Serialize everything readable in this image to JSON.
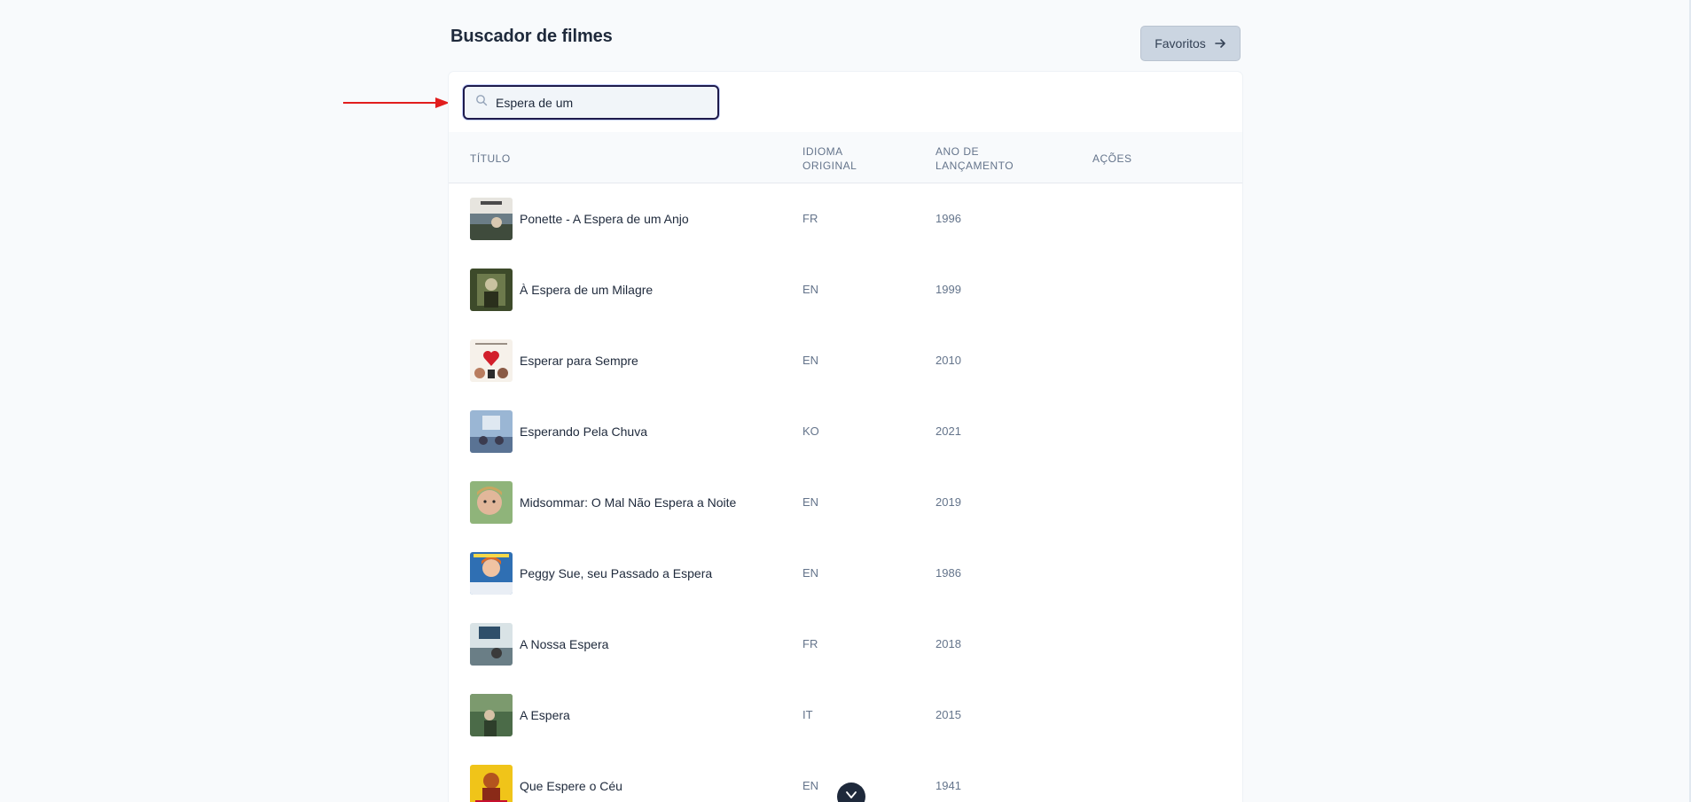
{
  "header": {
    "title": "Buscador de filmes",
    "favorites_label": "Favoritos"
  },
  "search": {
    "value": "Espera de um",
    "placeholder": ""
  },
  "table": {
    "columns": {
      "title": "Título",
      "language": "Idioma Original",
      "year": "Ano de Lançamento",
      "actions": "Ações"
    },
    "rows": [
      {
        "title": "Ponette - A Espera de um Anjo",
        "language": "FR",
        "year": "1996"
      },
      {
        "title": "À Espera de um Milagre",
        "language": "EN",
        "year": "1999"
      },
      {
        "title": "Esperar para Sempre",
        "language": "EN",
        "year": "2010"
      },
      {
        "title": "Esperando Pela Chuva",
        "language": "KO",
        "year": "2021"
      },
      {
        "title": "Midsommar: O Mal Não Espera a Noite",
        "language": "EN",
        "year": "2019"
      },
      {
        "title": "Peggy Sue, seu Passado a Espera",
        "language": "EN",
        "year": "1986"
      },
      {
        "title": "A Nossa Espera",
        "language": "FR",
        "year": "2018"
      },
      {
        "title": "A Espera",
        "language": "IT",
        "year": "2015"
      },
      {
        "title": "Que Espere o Céu",
        "language": "EN",
        "year": "1941"
      }
    ]
  },
  "colors": {
    "accent": "#1e1b4b",
    "annotation_arrow": "#e11d1d",
    "button_bg": "#cbd5e1"
  }
}
